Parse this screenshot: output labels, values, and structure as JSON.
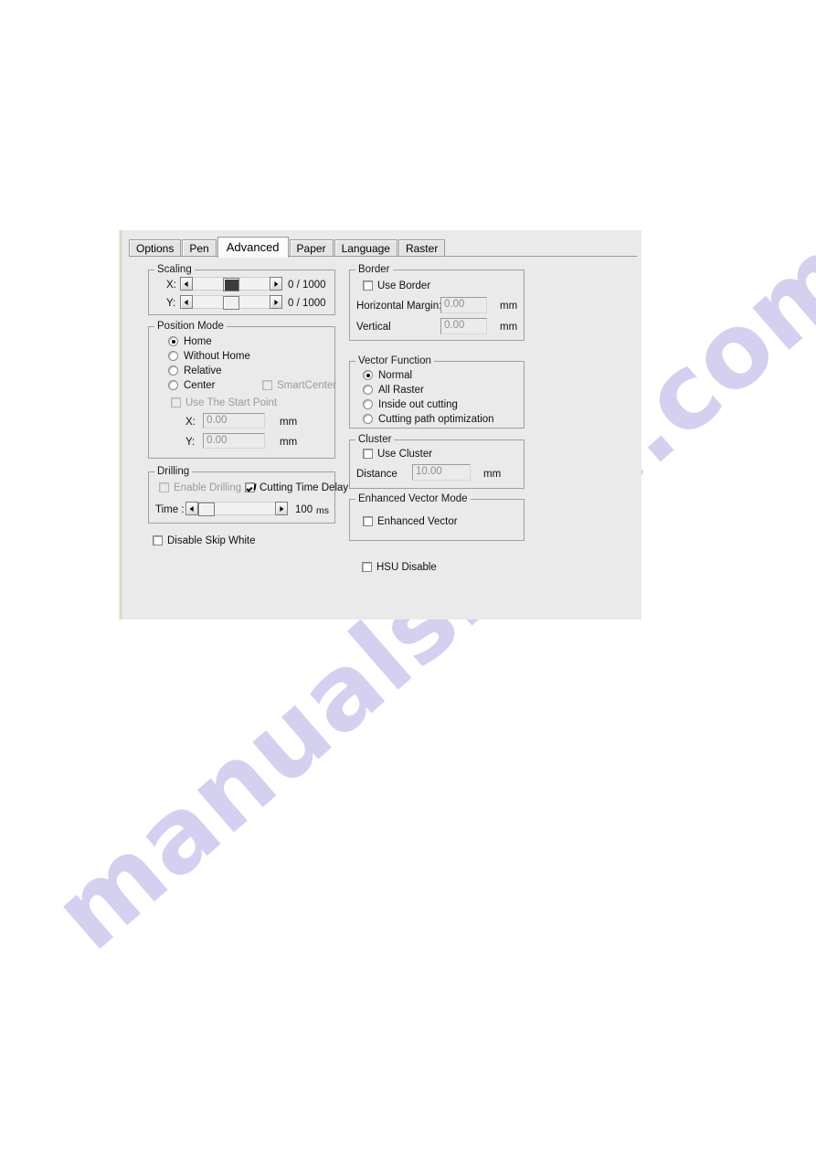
{
  "dialog": {
    "tabs": [
      {
        "label": "Options",
        "selected": false
      },
      {
        "label": "Pen",
        "selected": false
      },
      {
        "label": "Advanced",
        "selected": true
      },
      {
        "label": "Paper",
        "selected": false
      },
      {
        "label": "Language",
        "selected": false
      },
      {
        "label": "Raster",
        "selected": false
      }
    ],
    "scaling": {
      "legend": "Scaling",
      "rows": [
        {
          "axis": "X:",
          "value": "0 / 1000"
        },
        {
          "axis": "Y:",
          "value": "0 / 1000"
        }
      ]
    },
    "position_mode": {
      "legend": "Position Mode",
      "options": [
        "Home",
        "Without Home",
        "Relative",
        "Center"
      ],
      "selected": "Home",
      "smart_center": {
        "label": "SmartCenter",
        "checked": false,
        "enabled": false
      },
      "use_start_point": {
        "label": "Use The Start Point",
        "checked": false,
        "enabled": false
      },
      "x": {
        "label": "X:",
        "value": "0.00",
        "unit": "mm"
      },
      "y": {
        "label": "Y:",
        "value": "0.00",
        "unit": "mm"
      }
    },
    "drilling": {
      "legend": "Drilling",
      "enable_drilling": {
        "label": "Enable Drilling",
        "checked": false,
        "enabled": false
      },
      "cutting_time_delay": {
        "label": "Cutting Time Delay",
        "checked": true,
        "enabled": true
      },
      "time_label": "Time :",
      "time_value": "100",
      "time_unit": "ms"
    },
    "disable_skip_white": {
      "label": "Disable Skip White",
      "checked": false
    },
    "border": {
      "legend": "Border",
      "use_border": {
        "label": "Use Border",
        "checked": false
      },
      "horizontal_margin": {
        "label": "Horizontal Margin:",
        "value": "0.00",
        "unit": "mm"
      },
      "vertical": {
        "label": "Vertical",
        "value": "0.00",
        "unit": "mm"
      }
    },
    "vector_function": {
      "legend": "Vector Function",
      "options": [
        "Normal",
        "All Raster",
        "Inside out cutting",
        "Cutting path optimization"
      ],
      "selected": "Normal"
    },
    "cluster": {
      "legend": "Cluster",
      "use_cluster": {
        "label": "Use Cluster",
        "checked": false
      },
      "distance": {
        "label": "Distance",
        "value": "10.00",
        "unit": "mm"
      }
    },
    "enhanced_vector_mode": {
      "legend": "Enhanced Vector Mode",
      "enhanced_vector": {
        "label": "Enhanced Vector",
        "checked": false
      }
    },
    "hsu_disable": {
      "label": "HSU Disable",
      "checked": false
    }
  },
  "watermark": {
    "text": "manualshive.com"
  },
  "colors": {
    "dialog_bg": "#eaeaea",
    "page_bg": "#ffffff",
    "group_border": "#a0a0a0",
    "disabled_text": "#9b9b9b",
    "watermark": "#b9b6e6"
  }
}
